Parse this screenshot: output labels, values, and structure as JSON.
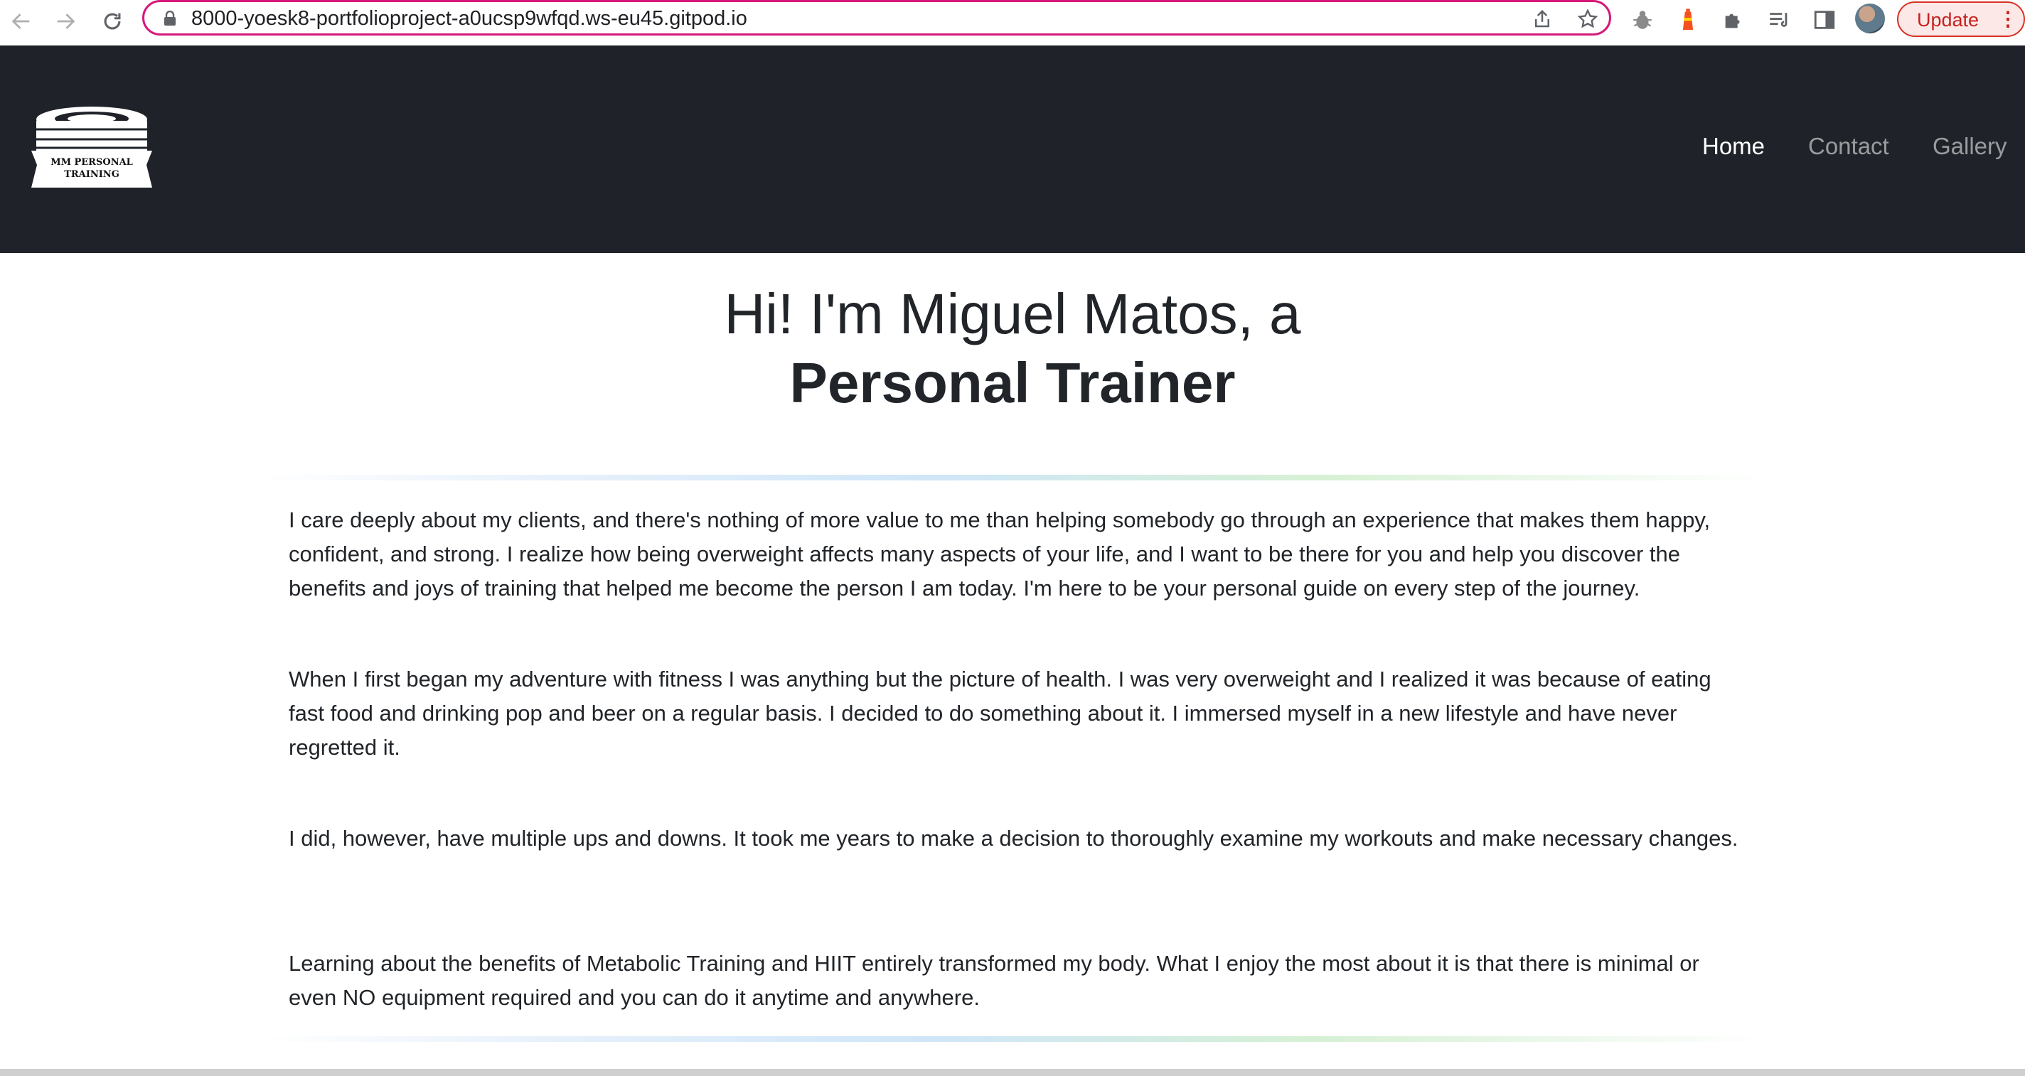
{
  "browser": {
    "url": "8000-yoesk8-portfolioproject-a0ucsp9wfqd.ws-eu45.gitpod.io",
    "update_label": "Update",
    "menu_glyph": "⋮",
    "icons": [
      "back-icon",
      "forward-icon",
      "reload-icon",
      "lock-icon",
      "share-icon",
      "bookmark-star-icon",
      "bug-extension-icon",
      "lighthouse-extension-icon",
      "puzzle-extension-icon",
      "media-queue-icon",
      "side-panel-icon",
      "profile-avatar"
    ],
    "accent": "#d6187a"
  },
  "site": {
    "logo_text": "MM PERSONAL TRAINING",
    "logo_line1": "MM PERSONAL",
    "logo_line2": "TRAINING",
    "nav": [
      {
        "label": "Home",
        "active": true
      },
      {
        "label": "Contact",
        "active": false
      },
      {
        "label": "Gallery",
        "active": false
      }
    ],
    "header_bg": "#1f2329"
  },
  "hero": {
    "line1": "Hi! I'm Miguel Matos, a",
    "line2": "Personal Trainer"
  },
  "about": {
    "paragraphs": [
      "I care deeply about my clients, and there's nothing of more value to me than helping somebody go through an experience that makes them happy, confident, and strong. I realize how being overweight affects many aspects of your life, and I want to be there for you and help you discover the benefits and joys of training that helped me become the person I am today. I'm here to be your personal guide on every step of the journey.",
      "When I first began my adventure with fitness I was anything but the picture of health. I was very overweight and I realized it was because of eating fast food and drinking pop and beer on a regular basis. I decided to do something about it. I immersed myself in a new lifestyle and have never regretted it.",
      "I did, however, have multiple ups and downs. It took me years to make a decision to thoroughly examine my workouts and make necessary changes.",
      "Learning about the benefits of Metabolic Training and HIIT entirely transformed my body. What I enjoy the most about it is that there is minimal or even NO equipment required and you can do it anytime and anywhere."
    ]
  }
}
